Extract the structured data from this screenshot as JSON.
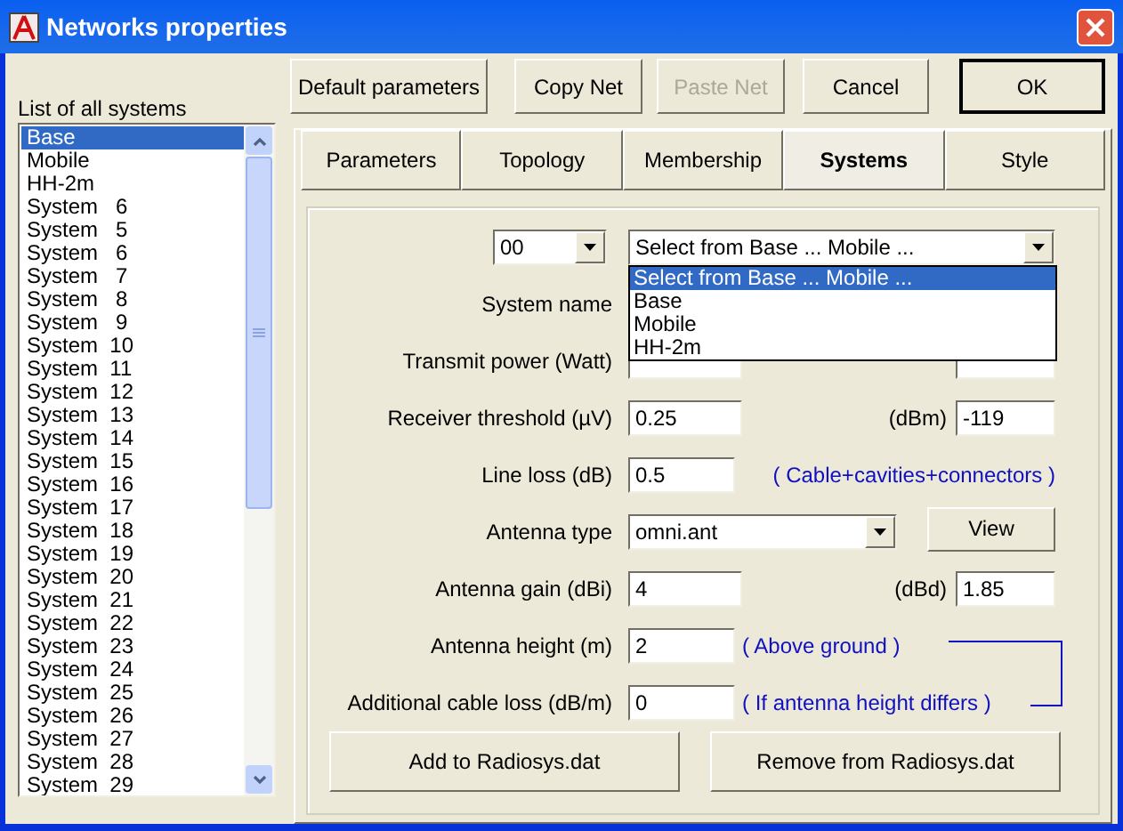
{
  "window": {
    "title": "Networks properties"
  },
  "toolbar": [
    {
      "label": "Default parameters",
      "disabled": false,
      "default": false
    },
    {
      "label": "Copy Net",
      "disabled": false,
      "default": false
    },
    {
      "label": "Paste Net",
      "disabled": true,
      "default": false
    },
    {
      "label": "Cancel",
      "disabled": false,
      "default": false
    },
    {
      "label": "OK",
      "disabled": false,
      "default": true
    }
  ],
  "systems_list": {
    "label": "List of all systems",
    "items": [
      {
        "label": "Base",
        "selected": true
      },
      {
        "label": "Mobile",
        "selected": false
      },
      {
        "label": "HH-2m",
        "selected": false
      },
      {
        "label": "System   6",
        "selected": false
      },
      {
        "label": "System   5",
        "selected": false
      },
      {
        "label": "System   6",
        "selected": false
      },
      {
        "label": "System   7",
        "selected": false
      },
      {
        "label": "System   8",
        "selected": false
      },
      {
        "label": "System   9",
        "selected": false
      },
      {
        "label": "System  10",
        "selected": false
      },
      {
        "label": "System  11",
        "selected": false
      },
      {
        "label": "System  12",
        "selected": false
      },
      {
        "label": "System  13",
        "selected": false
      },
      {
        "label": "System  14",
        "selected": false
      },
      {
        "label": "System  15",
        "selected": false
      },
      {
        "label": "System  16",
        "selected": false
      },
      {
        "label": "System  17",
        "selected": false
      },
      {
        "label": "System  18",
        "selected": false
      },
      {
        "label": "System  19",
        "selected": false
      },
      {
        "label": "System  20",
        "selected": false
      },
      {
        "label": "System  21",
        "selected": false
      },
      {
        "label": "System  22",
        "selected": false
      },
      {
        "label": "System  23",
        "selected": false
      },
      {
        "label": "System  24",
        "selected": false
      },
      {
        "label": "System  25",
        "selected": false
      },
      {
        "label": "System  26",
        "selected": false
      },
      {
        "label": "System  27",
        "selected": false
      },
      {
        "label": "System  28",
        "selected": false
      },
      {
        "label": "System  29",
        "selected": false
      }
    ]
  },
  "tabs": [
    {
      "label": "Parameters",
      "selected": false
    },
    {
      "label": "Topology",
      "selected": false
    },
    {
      "label": "Membership",
      "selected": false
    },
    {
      "label": "Systems",
      "selected": true
    },
    {
      "label": "Style",
      "selected": false
    }
  ],
  "form": {
    "number_combo": {
      "value": "00"
    },
    "system_combo": {
      "value": "Select from Base ... Mobile ...",
      "expanded": true,
      "options": [
        {
          "label": "Select from Base ... Mobile ...",
          "selected": true
        },
        {
          "label": "Base",
          "selected": false
        },
        {
          "label": "Mobile",
          "selected": false
        },
        {
          "label": "HH-2m",
          "selected": false
        }
      ]
    },
    "rows": [
      {
        "kind": "label",
        "label": "System name"
      },
      {
        "kind": "field",
        "label": "Transmit power (Watt)",
        "unit_field": true
      },
      {
        "kind": "field",
        "label": "Receiver threshold (µV)",
        "value": "0.25",
        "unit": "(dBm)",
        "unit_value": "-119"
      },
      {
        "kind": "field",
        "label": "Line loss (dB)",
        "value": "0.5",
        "note": "( Cable+cavities+connectors )"
      },
      {
        "kind": "combo",
        "label": "Antenna type",
        "value": "omni.ant",
        "button": "View"
      },
      {
        "kind": "field",
        "label": "Antenna gain (dBi)",
        "value": "4",
        "unit": "(dBd)",
        "unit_value": "1.85"
      },
      {
        "kind": "field",
        "label": "Antenna height (m)",
        "value": "2",
        "note": "( Above ground )"
      },
      {
        "kind": "field",
        "label": "Additional cable loss (dB/m)",
        "value": "0",
        "note": "( If antenna height differs )"
      }
    ],
    "buttons": [
      "Add to Radiosys.dat",
      "Remove from Radiosys.dat"
    ]
  }
}
